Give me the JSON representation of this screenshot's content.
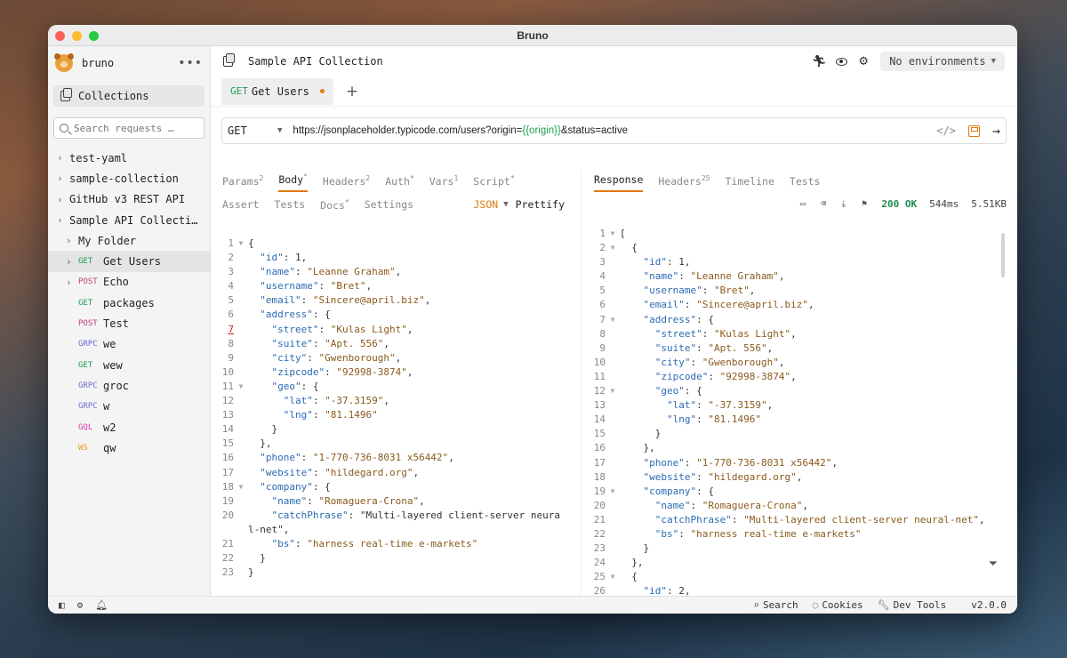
{
  "window": {
    "title": "Bruno"
  },
  "sidebar": {
    "workspace": "bruno",
    "collections_label": "Collections",
    "search_placeholder": "Search requests …",
    "items": [
      {
        "label": "test-yaml",
        "method": "",
        "level": 0,
        "chevron": true
      },
      {
        "label": "sample-collection",
        "method": "",
        "level": 0,
        "chevron": true
      },
      {
        "label": "GitHub v3 REST API",
        "method": "",
        "level": 0,
        "chevron": true
      },
      {
        "label": "Sample API Collecti…",
        "method": "",
        "level": 0,
        "chevron": true
      },
      {
        "label": "My Folder",
        "method": "",
        "level": 1,
        "chevron": true
      },
      {
        "label": "Get Users",
        "method": "GET",
        "level": 1,
        "chevron": true,
        "active": true
      },
      {
        "label": "Echo",
        "method": "POST",
        "level": 1,
        "chevron": true
      },
      {
        "label": "packages",
        "method": "GET",
        "level": 1,
        "chevron": false
      },
      {
        "label": "Test",
        "method": "POST",
        "level": 1,
        "chevron": false
      },
      {
        "label": "we",
        "method": "GRPC",
        "level": 1,
        "chevron": false
      },
      {
        "label": "wew",
        "method": "GET",
        "level": 1,
        "chevron": false
      },
      {
        "label": "groc",
        "method": "GRPC",
        "level": 1,
        "chevron": false
      },
      {
        "label": "w",
        "method": "GRPC",
        "level": 1,
        "chevron": false
      },
      {
        "label": "w2",
        "method": "GQL",
        "level": 1,
        "chevron": false
      },
      {
        "label": "qw",
        "method": "WS",
        "level": 1,
        "chevron": false
      }
    ]
  },
  "header": {
    "collection_title": "Sample API Collection",
    "environment": "No environments"
  },
  "request_tab": {
    "method": "GET",
    "name": "Get Users",
    "add_label": "+"
  },
  "url_bar": {
    "method": "GET",
    "url_prefix": "https://jsonplaceholder.typicode.com/users?origin=",
    "url_var": "{{origin}}",
    "url_suffix": "&status=active"
  },
  "request_pane": {
    "tabs": [
      {
        "label": "Params",
        "badge": "2"
      },
      {
        "label": "Body",
        "badge": "*",
        "active": true
      },
      {
        "label": "Headers",
        "badge": "2"
      },
      {
        "label": "Auth",
        "badge": "*"
      },
      {
        "label": "Vars",
        "badge": "1"
      },
      {
        "label": "Script",
        "badge": "*"
      }
    ],
    "tabs2": [
      {
        "label": "Assert",
        "badge": ""
      },
      {
        "label": "Tests",
        "badge": ""
      },
      {
        "label": "Docs",
        "badge": "*"
      },
      {
        "label": "Settings",
        "badge": ""
      }
    ],
    "mode": "JSON",
    "prettify": "Prettify",
    "error_line": "7",
    "code": [
      {
        "n": "1",
        "f": "▼",
        "t": "{"
      },
      {
        "n": "2",
        "f": "",
        "t": "  \"id\": 1,"
      },
      {
        "n": "3",
        "f": "",
        "t": "  \"name\": \"Leanne Graham\","
      },
      {
        "n": "4",
        "f": "",
        "t": "  \"username\": \"Bret\","
      },
      {
        "n": "5",
        "f": "",
        "t": "  \"email\": \"Sincere@april.biz\","
      },
      {
        "n": "6",
        "f": "",
        "t": "  \"address\": {"
      },
      {
        "n": "7",
        "f": "",
        "t": "    \"street\": \"Kulas Light\","
      },
      {
        "n": "8",
        "f": "",
        "t": "    \"suite\": \"Apt. 556\","
      },
      {
        "n": "9",
        "f": "",
        "t": "    \"city\": \"Gwenborough\","
      },
      {
        "n": "10",
        "f": "",
        "t": "    \"zipcode\": \"92998-3874\","
      },
      {
        "n": "11",
        "f": "▼",
        "t": "    \"geo\": {"
      },
      {
        "n": "12",
        "f": "",
        "t": "      \"lat\": \"-37.3159\","
      },
      {
        "n": "13",
        "f": "",
        "t": "      \"lng\": \"81.1496\""
      },
      {
        "n": "14",
        "f": "",
        "t": "    }"
      },
      {
        "n": "15",
        "f": "",
        "t": "  },"
      },
      {
        "n": "16",
        "f": "",
        "t": "  \"phone\": \"1-770-736-8031 x56442\","
      },
      {
        "n": "17",
        "f": "",
        "t": "  \"website\": \"hildegard.org\","
      },
      {
        "n": "18",
        "f": "▼",
        "t": "  \"company\": {"
      },
      {
        "n": "19",
        "f": "",
        "t": "    \"name\": \"Romaguera-Crona\","
      },
      {
        "n": "20",
        "f": "",
        "t": "    \"catchPhrase\": \"Multi-layered client-server neura"
      },
      {
        "n": "",
        "f": "",
        "t": "l-net\","
      },
      {
        "n": "21",
        "f": "",
        "t": "    \"bs\": \"harness real-time e-markets\""
      },
      {
        "n": "22",
        "f": "",
        "t": "  }"
      },
      {
        "n": "23",
        "f": "",
        "t": "}"
      }
    ]
  },
  "response_pane": {
    "tabs": [
      {
        "label": "Response",
        "badge": "",
        "active": true
      },
      {
        "label": "Headers",
        "badge": "25"
      },
      {
        "label": "Timeline",
        "badge": ""
      },
      {
        "label": "Tests",
        "badge": ""
      }
    ],
    "status": "200 OK",
    "time": "544ms",
    "size": "5.51KB",
    "code": [
      {
        "n": "1",
        "f": "▼",
        "t": "["
      },
      {
        "n": "2",
        "f": "▼",
        "t": "  {"
      },
      {
        "n": "3",
        "f": "",
        "t": "    \"id\": 1,"
      },
      {
        "n": "4",
        "f": "",
        "t": "    \"name\": \"Leanne Graham\","
      },
      {
        "n": "5",
        "f": "",
        "t": "    \"username\": \"Bret\","
      },
      {
        "n": "6",
        "f": "",
        "t": "    \"email\": \"Sincere@april.biz\","
      },
      {
        "n": "7",
        "f": "▼",
        "t": "    \"address\": {"
      },
      {
        "n": "8",
        "f": "",
        "t": "      \"street\": \"Kulas Light\","
      },
      {
        "n": "9",
        "f": "",
        "t": "      \"suite\": \"Apt. 556\","
      },
      {
        "n": "10",
        "f": "",
        "t": "      \"city\": \"Gwenborough\","
      },
      {
        "n": "11",
        "f": "",
        "t": "      \"zipcode\": \"92998-3874\","
      },
      {
        "n": "12",
        "f": "▼",
        "t": "      \"geo\": {"
      },
      {
        "n": "13",
        "f": "",
        "t": "        \"lat\": \"-37.3159\","
      },
      {
        "n": "14",
        "f": "",
        "t": "        \"lng\": \"81.1496\""
      },
      {
        "n": "15",
        "f": "",
        "t": "      }"
      },
      {
        "n": "16",
        "f": "",
        "t": "    },"
      },
      {
        "n": "17",
        "f": "",
        "t": "    \"phone\": \"1-770-736-8031 x56442\","
      },
      {
        "n": "18",
        "f": "",
        "t": "    \"website\": \"hildegard.org\","
      },
      {
        "n": "19",
        "f": "▼",
        "t": "    \"company\": {"
      },
      {
        "n": "20",
        "f": "",
        "t": "      \"name\": \"Romaguera-Crona\","
      },
      {
        "n": "21",
        "f": "",
        "t": "      \"catchPhrase\": \"Multi-layered client-server neural-net\","
      },
      {
        "n": "22",
        "f": "",
        "t": "      \"bs\": \"harness real-time e-markets\""
      },
      {
        "n": "23",
        "f": "",
        "t": "    }"
      },
      {
        "n": "24",
        "f": "",
        "t": "  },"
      },
      {
        "n": "25",
        "f": "▼",
        "t": "  {"
      },
      {
        "n": "26",
        "f": "",
        "t": "    \"id\": 2,"
      }
    ]
  },
  "statusbar": {
    "search": "Search",
    "cookies": "Cookies",
    "devtools": "Dev Tools",
    "version": "v2.0.0"
  },
  "colors": {
    "accent": "#e07a10",
    "get": "#1f9d4d",
    "post": "#c13b7b",
    "grpc": "#6b6bd6",
    "gql": "#e535ab",
    "ws": "#e89b1a",
    "json_key": "#2c6bb3",
    "json_string": "#8a5a1c",
    "status_ok": "#1f8a4c"
  }
}
